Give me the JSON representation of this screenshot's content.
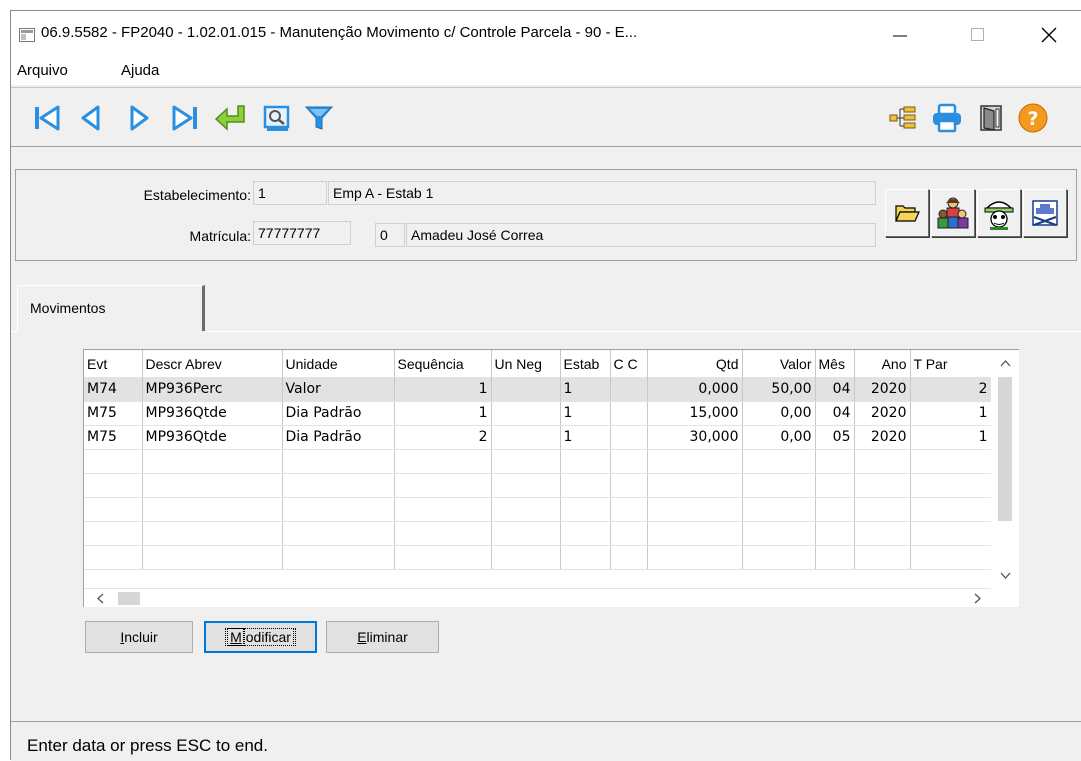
{
  "window": {
    "title": "06.9.5582 - FP2040 - 1.02.01.015 - Manutenção Movimento c/ Controle Parcela - 90 - E..."
  },
  "menu": {
    "items": [
      "Arquivo",
      "Ajuda"
    ]
  },
  "toolbar": {
    "left_icons": [
      "first-record-icon",
      "previous-record-icon",
      "next-record-icon",
      "last-record-icon",
      "return-icon",
      "zoom-icon",
      "filter-icon"
    ],
    "right_icons": [
      "tree-icon",
      "print-icon",
      "exit-icon",
      "help-icon"
    ]
  },
  "header": {
    "estabelecimento_label": "Estabelecimento:",
    "estabelecimento_code": "1",
    "estabelecimento_name": "Emp A - Estab 1",
    "matricula_label": "Matrícula:",
    "matricula_value": "77777777",
    "matricula_digit": "0",
    "employee_name": "Amadeu José Correa"
  },
  "action_icons": [
    "open-folder-icon",
    "people-icon",
    "detective-icon",
    "film-icon"
  ],
  "tabs": [
    {
      "label": "Movimentos"
    }
  ],
  "grid": {
    "columns": [
      "Evt",
      "Descr Abrev",
      "Unidade",
      "Sequência",
      "Un Neg",
      "Estab",
      "C C",
      "Qtd",
      "Valor",
      "Mês",
      "Ano",
      "T Par"
    ],
    "rows": [
      [
        "M74",
        "MP936Perc",
        "Valor",
        "1",
        "",
        "1",
        "",
        "0,000",
        "50,00",
        "04",
        "2020",
        "2"
      ],
      [
        "M75",
        "MP936Qtde",
        "Dia Padrão",
        "1",
        "",
        "1",
        "",
        "15,000",
        "0,00",
        "04",
        "2020",
        "1"
      ],
      [
        "M75",
        "MP936Qtde",
        "Dia Padrão",
        "2",
        "",
        "1",
        "",
        "30,000",
        "0,00",
        "05",
        "2020",
        "1"
      ]
    ],
    "empty_rows": 5
  },
  "buttons": {
    "incluir_first": "I",
    "incluir_rest": "ncluir",
    "modificar_first": "M",
    "modificar_rest": "odificar",
    "eliminar_first": "E",
    "eliminar_rest": "liminar"
  },
  "status": {
    "text": "Enter data or press ESC to end."
  }
}
